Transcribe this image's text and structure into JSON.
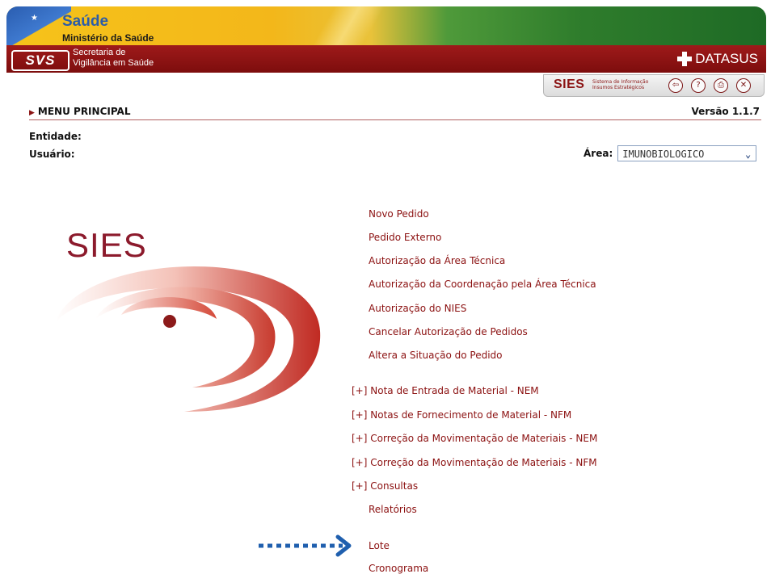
{
  "header": {
    "saude_title": "Saúde",
    "saude_subtitle": "Ministério da Saúde",
    "svs_logo": "SVS",
    "svs_line1": "Secretaria de",
    "svs_line2": "Vigilância em Saúde",
    "datasus": "DATASUS"
  },
  "toolbar": {
    "sies_logo": "SIES",
    "sies_sub_line1": "Sistema de Informação",
    "sies_sub_line2": "Insumos Estratégicos",
    "buttons": [
      {
        "icon": "back-icon",
        "glyph": "⇦"
      },
      {
        "icon": "help-icon",
        "glyph": "?"
      },
      {
        "icon": "print-icon",
        "glyph": "⎙"
      },
      {
        "icon": "close-icon",
        "glyph": "✕"
      }
    ]
  },
  "page": {
    "menu_title": "MENU PRINCIPAL",
    "version": "Versão 1.1.7",
    "entidade_label": "Entidade:",
    "usuario_label": "Usuário:",
    "area_label": "Área:",
    "area_value": "IMUNOBIOLOGICO",
    "logo_text": "SIES"
  },
  "menu": {
    "items": [
      {
        "label": "Novo Pedido",
        "expand": ""
      },
      {
        "label": "Pedido Externo",
        "expand": ""
      },
      {
        "label": "Autorização da Área Técnica",
        "expand": ""
      },
      {
        "label": "Autorização da Coordenação pela Área Técnica",
        "expand": ""
      },
      {
        "label": "Autorização do NIES",
        "expand": ""
      },
      {
        "label": "Cancelar Autorização de Pedidos",
        "expand": ""
      },
      {
        "label": "Altera a Situação do Pedido",
        "expand": ""
      },
      {
        "label": "Nota de Entrada de Material - NEM",
        "expand": "[+]"
      },
      {
        "label": "Notas de Fornecimento de Material - NFM",
        "expand": "[+]"
      },
      {
        "label": "Correção da Movimentação de Materiais - NEM",
        "expand": "[+]"
      },
      {
        "label": "Correção da Movimentação de Materiais - NFM",
        "expand": "[+]"
      },
      {
        "label": "Consultas",
        "expand": "[+]"
      },
      {
        "label": "Relatórios",
        "expand": ""
      },
      {
        "label": "Lote",
        "expand": ""
      },
      {
        "label": "Cronograma",
        "expand": ""
      }
    ]
  },
  "colors": {
    "accent_red": "#8b1010",
    "highlight_arrow": "#1f5fae"
  }
}
